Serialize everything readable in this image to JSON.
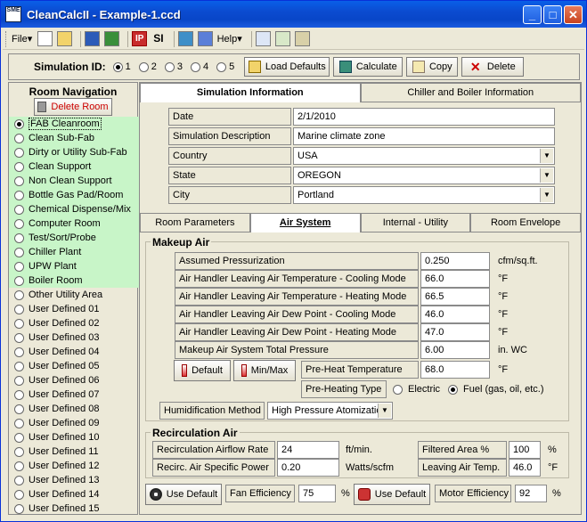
{
  "window": {
    "title": "CleanCalcII - Example-1.ccd",
    "icon_text": "SME"
  },
  "menu": {
    "file": "File",
    "ip": "IP",
    "si": "SI",
    "help": "Help"
  },
  "sim": {
    "label": "Simulation ID:",
    "ids": [
      "1",
      "2",
      "3",
      "4",
      "5"
    ],
    "selected": "1",
    "load_defaults": "Load Defaults",
    "calculate": "Calculate",
    "copy": "Copy",
    "delete": "Delete"
  },
  "nav": {
    "title": "Room Navigation",
    "delete_room": "Delete Room",
    "rooms": [
      "FAB Cleanroom",
      "Clean Sub-Fab",
      "Dirty or Utility Sub-Fab",
      "Clean Support",
      "Non Clean Support",
      "Bottle Gas Pad/Room",
      "Chemical Dispense/Mix",
      "Computer Room",
      "Test/Sort/Probe",
      "Chiller Plant",
      "UPW Plant",
      "Boiler Room",
      "Other Utility Area",
      "User Defined 01",
      "User Defined 02",
      "User Defined 03",
      "User Defined 04",
      "User Defined 05",
      "User Defined 06",
      "User Defined 07",
      "User Defined 08",
      "User Defined 09",
      "User Defined 10",
      "User Defined 11",
      "User Defined 12",
      "User Defined 13",
      "User Defined 14",
      "User Defined 15"
    ]
  },
  "top_tabs": {
    "sim_info": "Simulation Information",
    "chiller": "Chiller and Boiler Information"
  },
  "sim_info": {
    "date_label": "Date",
    "date": "2/1/2010",
    "desc_label": "Simulation Description",
    "desc": "Marine climate zone",
    "country_label": "Country",
    "country": "USA",
    "state_label": "State",
    "state": "OREGON",
    "city_label": "City",
    "city": "Portland"
  },
  "sub_tabs": {
    "room": "Room Parameters",
    "air": "Air System",
    "internal": "Internal - Utility",
    "envelope": "Room Envelope"
  },
  "makeup": {
    "title": "Makeup Air",
    "pressurization_label": "Assumed Pressurization",
    "pressurization": "0.250",
    "pressurization_unit": "cfm/sq.ft.",
    "cool_temp_label": "Air Handler Leaving Air Temperature - Cooling Mode",
    "cool_temp": "66.0",
    "heat_temp_label": "Air Handler Leaving Air Temperature - Heating Mode",
    "heat_temp": "66.5",
    "cool_dew_label": "Air Handler Leaving Air Dew Point - Cooling Mode",
    "cool_dew": "46.0",
    "heat_dew_label": "Air Handler Leaving Air Dew Point - Heating Mode",
    "heat_dew": "47.0",
    "pressure_label": "Makeup Air System Total Pressure",
    "pressure": "6.00",
    "pressure_unit": "in. WC",
    "deg_unit": "°F",
    "default_btn": "Default",
    "minmax_btn": "Min/Max",
    "preheat_label": "Pre-Heat Temperature",
    "preheat": "68.0",
    "preheat_type_label": "Pre-Heating Type",
    "electric": "Electric",
    "fuel": "Fuel (gas, oil, etc.)",
    "humid_label": "Humidification Method",
    "humid": "High Pressure Atomizatio"
  },
  "recirc": {
    "title": "Recirculation Air",
    "rate_label": "Recirculation Airflow Rate",
    "rate": "24",
    "rate_unit": "ft/min.",
    "power_label": "Recirc. Air Specific Power",
    "power": "0.20",
    "power_unit": "Watts/scfm",
    "filtered_label": "Filtered Area %",
    "filtered": "100",
    "pct": "%",
    "leaving_label": "Leaving Air Temp.",
    "leaving": "46.0",
    "leaving_unit": "°F",
    "use_default_1": "Use Default",
    "fan_eff_label": "Fan Efficiency",
    "fan_eff": "75",
    "use_default_2": "Use Default",
    "motor_eff_label": "Motor Efficiency",
    "motor_eff": "92"
  }
}
